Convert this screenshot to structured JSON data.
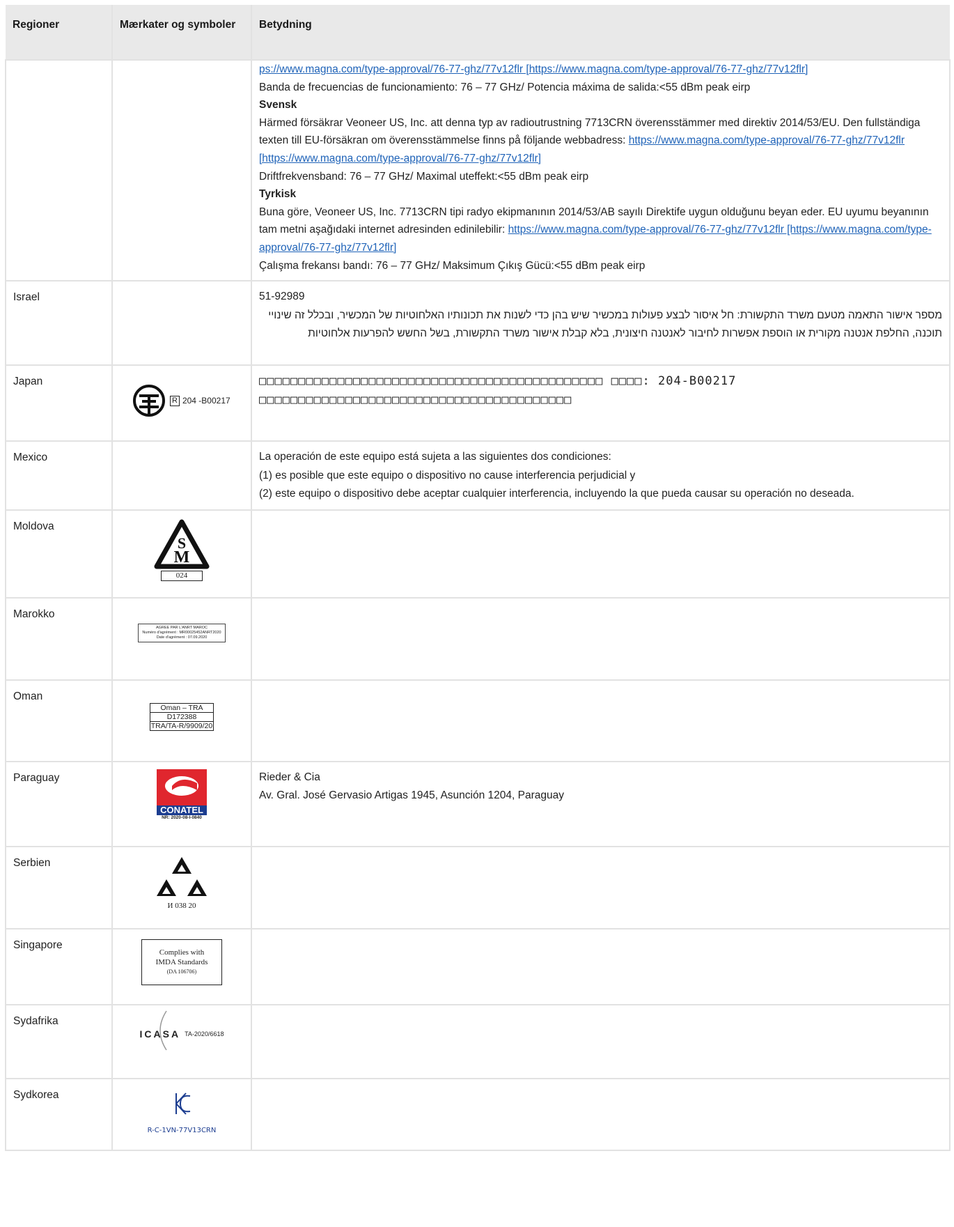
{
  "header": {
    "col1": "Regioner",
    "col2": "Mærkater og symboler",
    "col3": "Betydning"
  },
  "continuation": {
    "line1_link": "ps://www.magna.com/type-approval/76-77-ghz/77v12flr [https://www.magna.com/type-approval/76-77-ghz/77v12flr]",
    "spanish_band": "Banda de frecuencias de funcionamiento: 76 – 77 GHz/ Potencia máxima de salida:<55 dBm peak eirp",
    "svensk_heading": "Svensk",
    "svensk_text": "Härmed försäkrar Veoneer US, Inc. att denna typ av radioutrustning 7713CRN överensstämmer med direktiv 2014/53/EU. Den fullständiga texten till EU-försäkran om överensstämmelse finns på följande webbadress: ",
    "svensk_link": "https://www.magna.com/type-approval/76-77-ghz/77v12flr [https://www.magna.com/type-approval/76-77-ghz/77v12flr]",
    "svensk_band": "Driftfrekvensband: 76 – 77 GHz/ Maximal uteffekt:<55 dBm peak eirp",
    "tyrkisk_heading": "Tyrkisk",
    "tyrkisk_text": "Buna göre, Veoneer US, Inc. 7713CRN tipi radyo ekipmanının 2014/53/AB sayılı Direktife uygun olduğunu beyan eder. EU uyumu beyanının tam metni aşağıdaki internet adresinden edinilebilir: ",
    "tyrkisk_link": "https://www.magna.com/type-approval/76-77-ghz/77v12flr [https://www.magna.com/type-approval/76-77-ghz/77v12flr]",
    "tyrkisk_band": "Çalışma frekansı bandı: 76 – 77 GHz/ Maksimum Çıkış Gücü:<55 dBm peak eirp"
  },
  "rows": {
    "israel": {
      "region": "Israel",
      "line1": "51-92989",
      "line2": "מספר אישור התאמה מטעם משרד התקשורת: חל איסור לבצע פעולות במכשיר שיש בהן כדי לשנות את תכונותיו האלחוטיות של המכשיר, ובכלל זה שינויי תוכנה, החלפת אנטנה מקורית או הוספת אפשרות לחיבור לאנטנה חיצונית, בלא קבלת אישור משרד התקשורת, בשל החשש להפרעות אלחוטיות"
    },
    "japan": {
      "region": "Japan",
      "mark_r": "R",
      "mark_num": "204 -B00217",
      "line1": "□□□□□□□□□□□□□□□□□□□□□□□□□□□□□□□□□□□□□□□□□□□□ □□□□: 204-B00217",
      "line2": "□□□□□□□□□□□□□□□□□□□□□□□□□□□□□□□□□□□□□□□□"
    },
    "mexico": {
      "region": "Mexico",
      "line1": "La operación de este equipo está sujeta a las siguientes dos condiciones:",
      "line2": "(1) es posible que este equipo o dispositivo no cause interferencia perjudicial y",
      "line3": "(2) este equipo o dispositivo debe aceptar cualquier interferencia, incluyendo la que pueda causar su operación no deseada."
    },
    "moldova": {
      "region": "Moldova",
      "mark_num": "024"
    },
    "marokko": {
      "region": "Marokko",
      "mark_l1": "AGREE PAR L'ANRT MAROC",
      "mark_l2": "Numéro d'agrément : MR00025452ANRT2020",
      "mark_l3": "Date d'agrément : 07.09.2020"
    },
    "oman": {
      "region": "Oman",
      "mark_l1": "Oman – TRA",
      "mark_l2": "D172388",
      "mark_l3": "TRA/TA-R/9909/20"
    },
    "paraguay": {
      "region": "Paraguay",
      "mark_name": "CONATEL",
      "mark_nr": "NR: 2020-08-I-0840",
      "line1": "Rieder & Cia",
      "line2": "Av. Gral. José Gervasio Artigas 1945, Asunción 1204, Paraguay"
    },
    "serbien": {
      "region": "Serbien",
      "mark_num": "И 038 20"
    },
    "singapore": {
      "region": "Singapore",
      "mark_l1": "Complies with",
      "mark_l2": "IMDA Standards",
      "mark_l3": "(DA 106706)"
    },
    "sydafrika": {
      "region": "Sydafrika",
      "mark_logo": "ICASA",
      "mark_num": "TA-2020/6618"
    },
    "sydkorea": {
      "region": "Sydkorea",
      "mark_num": "R-C-1VN-77V13CRN"
    }
  }
}
